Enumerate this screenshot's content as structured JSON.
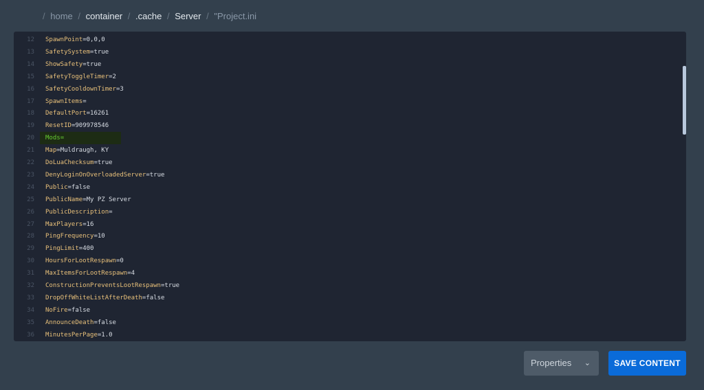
{
  "breadcrumb": {
    "segments": [
      "home",
      "container",
      ".cache",
      "Server"
    ],
    "file": "\"Project.ini"
  },
  "editor": {
    "lines": [
      {
        "n": "12",
        "key": "SpawnPoint",
        "val": "0,0,0"
      },
      {
        "n": "13",
        "key": "SafetySystem",
        "val": "true"
      },
      {
        "n": "14",
        "key": "ShowSafety",
        "val": "true"
      },
      {
        "n": "15",
        "key": "SafetyToggleTimer",
        "val": "2"
      },
      {
        "n": "16",
        "key": "SafetyCooldownTimer",
        "val": "3"
      },
      {
        "n": "17",
        "key": "SpawnItems",
        "val": ""
      },
      {
        "n": "18",
        "key": "DefaultPort",
        "val": "16261"
      },
      {
        "n": "19",
        "key": "ResetID",
        "val": "909978546"
      },
      {
        "n": "20",
        "key": "Mods",
        "val": "",
        "highlighted": true
      },
      {
        "n": "21",
        "key": "Map",
        "val": "Muldraugh, KY"
      },
      {
        "n": "22",
        "key": "DoLuaChecksum",
        "val": "true"
      },
      {
        "n": "23",
        "key": "DenyLoginOnOverloadedServer",
        "val": "true"
      },
      {
        "n": "24",
        "key": "Public",
        "val": "false"
      },
      {
        "n": "25",
        "key": "PublicName",
        "val": "My PZ Server"
      },
      {
        "n": "26",
        "key": "PublicDescription",
        "val": ""
      },
      {
        "n": "27",
        "key": "MaxPlayers",
        "val": "16"
      },
      {
        "n": "28",
        "key": "PingFrequency",
        "val": "10"
      },
      {
        "n": "29",
        "key": "PingLimit",
        "val": "400"
      },
      {
        "n": "30",
        "key": "HoursForLootRespawn",
        "val": "0"
      },
      {
        "n": "31",
        "key": "MaxItemsForLootRespawn",
        "val": "4"
      },
      {
        "n": "32",
        "key": "ConstructionPreventsLootRespawn",
        "val": "true"
      },
      {
        "n": "33",
        "key": "DropOffWhiteListAfterDeath",
        "val": "false"
      },
      {
        "n": "34",
        "key": "NoFire",
        "val": "false"
      },
      {
        "n": "35",
        "key": "AnnounceDeath",
        "val": "false"
      },
      {
        "n": "36",
        "key": "MinutesPerPage",
        "val": "1.0"
      }
    ]
  },
  "footer": {
    "mode_select": "Properties",
    "save_label": "SAVE CONTENT"
  },
  "colors": {
    "accent": "#0a6bd9",
    "key": "#e8c07a",
    "highlight": "#66cc33"
  }
}
